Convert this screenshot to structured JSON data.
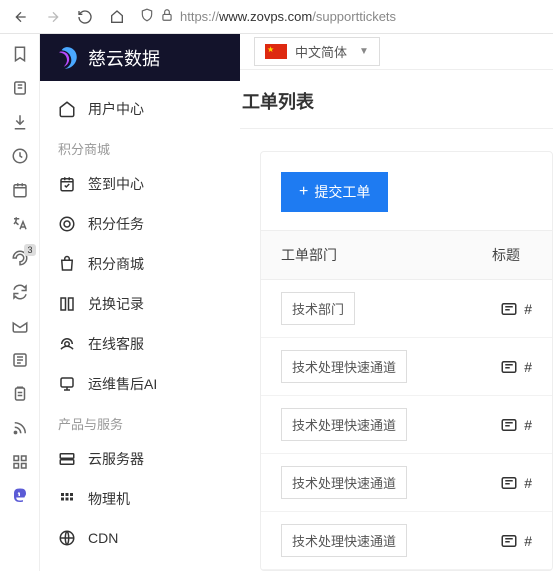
{
  "browser": {
    "url_scheme": "https://",
    "url_host": "www.zovps.com",
    "url_path": "/supporttickets"
  },
  "rail_badge": "3",
  "logo_text": "慈云数据",
  "lang_label": "中文简体",
  "nav": {
    "user_center": "用户中心",
    "section_points": "积分商城",
    "checkin": "签到中心",
    "points_tasks": "积分任务",
    "points_mall": "积分商城",
    "exchange_log": "兑换记录",
    "online_support": "在线客服",
    "ops_ai": "运维售后AI",
    "section_products": "产品与服务",
    "cloud_server": "云服务器",
    "physical": "物理机",
    "cdn": "CDN"
  },
  "page": {
    "title": "工单列表",
    "submit_btn": "提交工单",
    "col_dept": "工单部门",
    "col_title": "标题",
    "rows": [
      {
        "dept": "技术部门",
        "id": "#"
      },
      {
        "dept": "技术处理快速通道",
        "id": "#"
      },
      {
        "dept": "技术处理快速通道",
        "id": "#"
      },
      {
        "dept": "技术处理快速通道",
        "id": "#"
      },
      {
        "dept": "技术处理快速通道",
        "id": "#"
      }
    ]
  }
}
